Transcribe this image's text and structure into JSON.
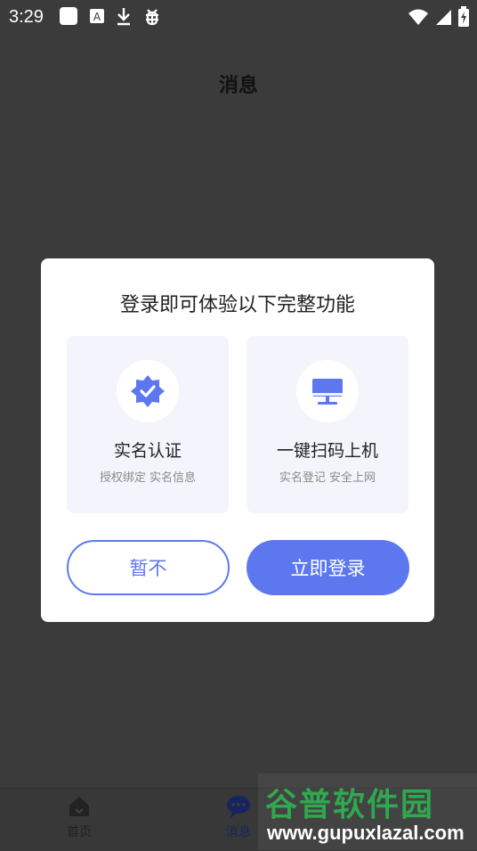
{
  "status_bar": {
    "time": "3:29",
    "icons_left": [
      "app-square-icon",
      "font-icon",
      "download-icon",
      "bug-icon"
    ],
    "icons_right": [
      "wifi-icon",
      "signal-icon",
      "battery-icon"
    ]
  },
  "header": {
    "title": "消息"
  },
  "dialog": {
    "title": "登录即可体验以下完整功能",
    "features": [
      {
        "name": "实名认证",
        "desc": "授权绑定 实名信息",
        "icon": "verified-badge-icon"
      },
      {
        "name": "一键扫码上机",
        "desc": "实名登记 安全上网",
        "icon": "computer-icon"
      }
    ],
    "later_label": "暂不",
    "login_label": "立即登录"
  },
  "tab_bar": {
    "items": [
      {
        "label": "首页",
        "icon": "home-icon"
      },
      {
        "label": "消息",
        "icon": "chat-icon"
      }
    ]
  },
  "watermark": {
    "title": "谷普软件园",
    "url": "www.gupuxlazal.com"
  },
  "colors": {
    "accent": "#5d78ef",
    "card_bg": "#f4f5fc",
    "overlay_bg": "#3b3b3b",
    "watermark_green": "#2fa84f"
  }
}
